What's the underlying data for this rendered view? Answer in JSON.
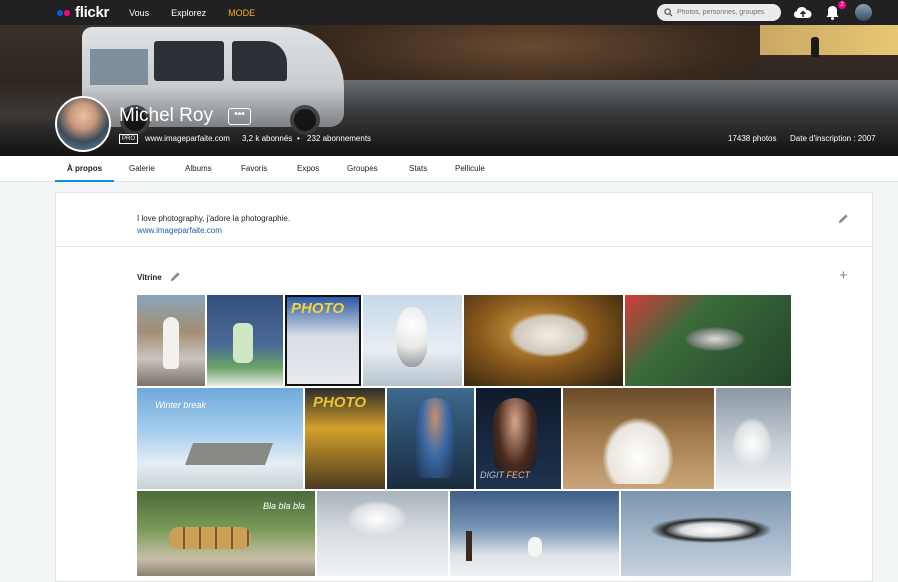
{
  "topbar": {
    "logo": "flickr",
    "nav": [
      "Vous",
      "Explorez",
      "MODE"
    ],
    "search_placeholder": "Photos, personnes, groupes",
    "notification_count": "2",
    "colors": {
      "bar": "#212124",
      "mode": "#f5b014",
      "badge": "#ff0084"
    }
  },
  "profile": {
    "name": "Michel Roy",
    "more_label": "•••",
    "pro_label": "PRO",
    "website": "www.imageparfaite.com",
    "followers": "3,2 k abonnés",
    "separator": "•",
    "following": "232 abonnements",
    "photos": "17438 photos",
    "joined": "Date d'inscription : 2007"
  },
  "tabs": [
    {
      "label": "À propos",
      "active": true
    },
    {
      "label": "Galerie"
    },
    {
      "label": "Albums"
    },
    {
      "label": "Favoris"
    },
    {
      "label": "Expos"
    },
    {
      "label": "Groupes"
    },
    {
      "label": "Stats"
    },
    {
      "label": "Pellicule"
    }
  ],
  "about": {
    "bio": "I love photography, j'adore la photographie.",
    "link": "www.imageparfaite.com"
  },
  "showcase": {
    "title": "Vitrine",
    "add_icon": "plus-icon",
    "photos": [
      {
        "subject": "girl-in-white-dress",
        "caption": ""
      },
      {
        "subject": "tennis-player-woman",
        "caption": ""
      },
      {
        "subject": "photo-news-magazine-white-wolf",
        "caption": "PHOTO"
      },
      {
        "subject": "snowy-owl",
        "caption": ""
      },
      {
        "subject": "running-horses",
        "caption": ""
      },
      {
        "subject": "hummingbird",
        "caption": ""
      },
      {
        "subject": "winter-wreck",
        "caption": "Winter break"
      },
      {
        "subject": "photo-news-magazine-african-safari",
        "caption": "PHOTO"
      },
      {
        "subject": "tennis-player-man",
        "caption": ""
      },
      {
        "subject": "woman-portrait",
        "caption": "DIGIT  FECT"
      },
      {
        "subject": "wedding-couple",
        "caption": ""
      },
      {
        "subject": "white-wolf",
        "caption": ""
      },
      {
        "subject": "ducklings",
        "caption": "Bla bla bla"
      },
      {
        "subject": "snowy-owl-flying",
        "caption": ""
      },
      {
        "subject": "snowy-owl-post",
        "caption": ""
      },
      {
        "subject": "snow-bunting-flying",
        "caption": ""
      }
    ]
  }
}
